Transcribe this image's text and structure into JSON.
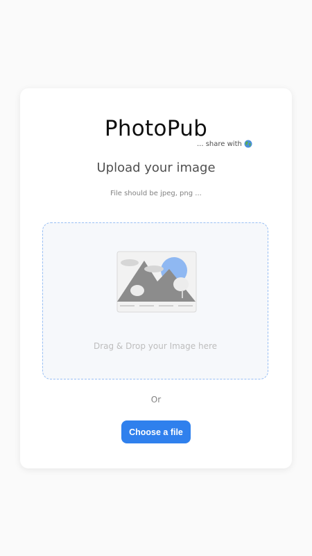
{
  "brand": {
    "name": "PhotoPub",
    "tagline": "... share with"
  },
  "upload": {
    "heading": "Upload your image",
    "hint": "File should be jpeg, png ...",
    "dropzone_label": "Drag & Drop your Image here",
    "or_label": "Or",
    "choose_button_label": "Choose a file"
  },
  "icons": {
    "tagline_icon": "globe-icon",
    "dropzone_image": "image-placeholder-icon"
  },
  "colors": {
    "accent": "#2f80ed",
    "dropzone_background": "#f6f8fb",
    "dropzone_border": "#97bef4",
    "page_background": "#fafafa"
  }
}
